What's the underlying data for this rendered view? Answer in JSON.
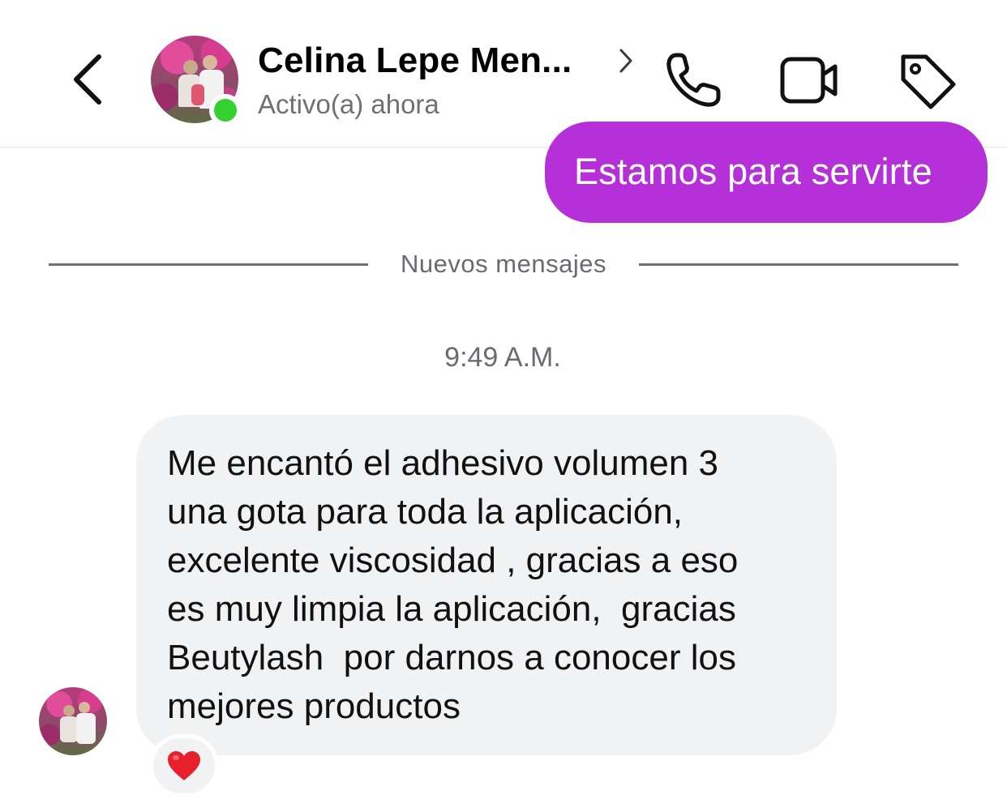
{
  "header": {
    "contact_name": "Celina Lepe Men...",
    "status": "Activo(a) ahora",
    "icons": {
      "back": "chevron-left-icon",
      "details": "chevron-right-icon",
      "call": "phone-icon",
      "video": "video-camera-icon",
      "label": "tag-icon"
    },
    "online_color": "#35d12f"
  },
  "conversation": {
    "outgoing_message": "Estamos para servirte",
    "outgoing_color": "#b530d8",
    "divider_label": "Nuevos mensajes",
    "timestamp": "9:49 A.M.",
    "incoming_message_lines": [
      "Me encantó el adhesivo volumen 3",
      "una gota para toda la aplicación,",
      "excelente viscosidad , gracias a eso",
      "es muy limpia la aplicación,  gracias",
      "Beutylash  por darnos a conocer los",
      "mejores productos"
    ],
    "reaction": "❤️"
  }
}
